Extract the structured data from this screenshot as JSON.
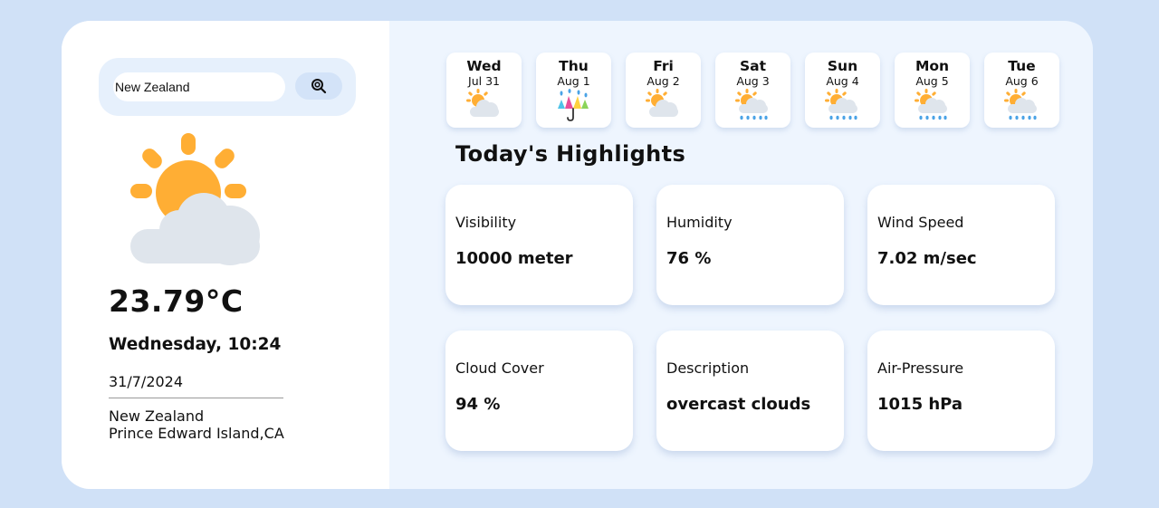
{
  "search": {
    "value": "New Zealand"
  },
  "current": {
    "temperature": "23.79",
    "unit": "°C",
    "day_time": "Wednesday, 10:24",
    "date": "31/7/2024",
    "location_line1": "New Zealand",
    "location_line2": "Prince Edward Island,CA",
    "icon": "sun-behind-cloud-icon"
  },
  "forecast": [
    {
      "day": "Wed",
      "date": "Jul 31",
      "icon": "sun-behind-cloud-icon"
    },
    {
      "day": "Thu",
      "date": "Aug 1",
      "icon": "umbrella-rain-icon"
    },
    {
      "day": "Fri",
      "date": "Aug 2",
      "icon": "sun-behind-cloud-icon"
    },
    {
      "day": "Sat",
      "date": "Aug 3",
      "icon": "sun-cloud-rain-icon"
    },
    {
      "day": "Sun",
      "date": "Aug 4",
      "icon": "sun-cloud-rain-icon"
    },
    {
      "day": "Mon",
      "date": "Aug 5",
      "icon": "sun-cloud-rain-icon"
    },
    {
      "day": "Tue",
      "date": "Aug 6",
      "icon": "sun-cloud-rain-icon"
    }
  ],
  "highlights": {
    "title": "Today's Highlights",
    "items": [
      {
        "label": "Visibility",
        "value": "10000 meter"
      },
      {
        "label": "Humidity",
        "value": "76 %"
      },
      {
        "label": "Wind Speed",
        "value": "7.02 m/sec"
      },
      {
        "label": "Cloud Cover",
        "value": "94 %"
      },
      {
        "label": "Description",
        "value": "overcast clouds"
      },
      {
        "label": "Air-Pressure",
        "value": "1015 hPa"
      }
    ]
  },
  "colors": {
    "page_bg": "#d0e1f7",
    "panel_bg": "#eef5fe",
    "sun": "#ffae34",
    "cloud": "#dfe5ec",
    "rain": "#4aa3e6"
  }
}
